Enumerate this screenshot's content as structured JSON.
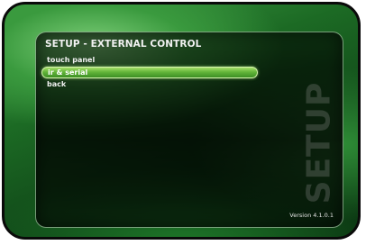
{
  "screen": {
    "title": "SETUP - EXTERNAL CONTROL",
    "watermark": "SETUP",
    "version": "Version 4.1.0.1"
  },
  "menu": {
    "items": [
      {
        "label": "touch panel",
        "selected": false
      },
      {
        "label": "ir & serial",
        "selected": true
      },
      {
        "label": "back",
        "selected": false
      }
    ]
  },
  "colors": {
    "background_green": "#1c6a24",
    "selection_green": "#63b53a",
    "frame": "#0a0a0a"
  }
}
